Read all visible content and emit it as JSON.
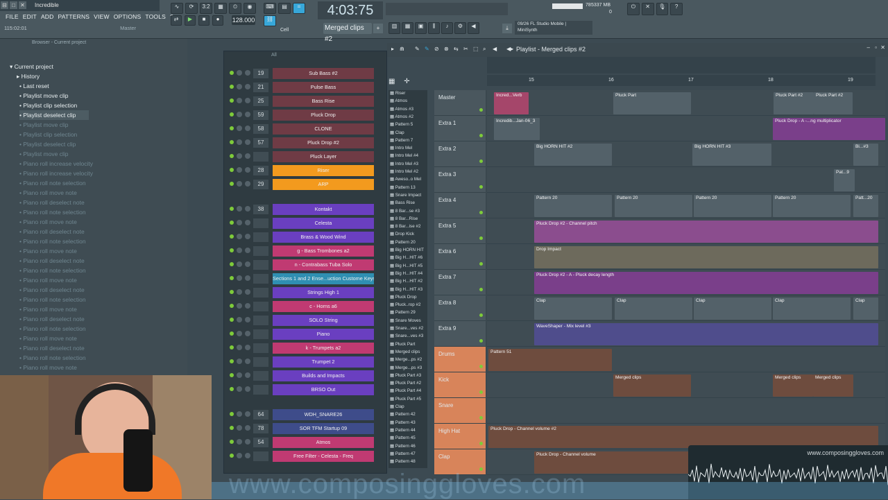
{
  "app": {
    "title": "Incredible",
    "window_buttons": [
      "⊟",
      "□",
      "✕"
    ],
    "menu": [
      "FILE",
      "EDIT",
      "ADD",
      "PATTERNS",
      "VIEW",
      "OPTIONS",
      "TOOLS",
      "?"
    ],
    "hint_left": "115:02:01",
    "hint_right": "Master"
  },
  "transport": {
    "time": "4:03:75",
    "tempo": "128.000",
    "pattern": "Merged clips #2",
    "snap": "Cell",
    "song_counter": "3:2",
    "hint_panel_line1": "09/26  FL Studio Mobile |",
    "hint_panel_line2": "MiniSynth",
    "cpu_value": "78",
    "mem": "5337 MB",
    "mem_small": "0"
  },
  "browser": {
    "header": "Browser - Current project",
    "items": [
      {
        "label": "Current project",
        "bright": true
      },
      {
        "label": "History",
        "bright": true
      },
      {
        "label": "Last reset",
        "bright": true
      },
      {
        "label": "Playlist move clip",
        "bright": true
      },
      {
        "label": "Playlist clip selection",
        "bright": true
      },
      {
        "label": "Playlist deselect clip",
        "bright": true
      },
      {
        "label": "Playlist move clip",
        "bright": false
      },
      {
        "label": "Playlist clip selection",
        "bright": false
      },
      {
        "label": "Playlist deselect clip",
        "bright": false
      },
      {
        "label": "Playlist move clip",
        "bright": false
      },
      {
        "label": "Piano roll increase velocity",
        "bright": false
      },
      {
        "label": "Piano roll increase velocity",
        "bright": false
      },
      {
        "label": "Piano roll note selection",
        "bright": false
      },
      {
        "label": "Piano roll move note",
        "bright": false
      },
      {
        "label": "Piano roll deselect note",
        "bright": false
      },
      {
        "label": "Piano roll note selection",
        "bright": false
      },
      {
        "label": "Piano roll move note",
        "bright": false
      },
      {
        "label": "Piano roll deselect note",
        "bright": false
      },
      {
        "label": "Piano roll note selection",
        "bright": false
      },
      {
        "label": "Piano roll move note",
        "bright": false
      },
      {
        "label": "Piano roll deselect note",
        "bright": false
      },
      {
        "label": "Piano roll note selection",
        "bright": false
      },
      {
        "label": "Piano roll move note",
        "bright": false
      },
      {
        "label": "Piano roll deselect note",
        "bright": false
      },
      {
        "label": "Piano roll note selection",
        "bright": false
      },
      {
        "label": "Piano roll move note",
        "bright": false
      },
      {
        "label": "Piano roll deselect note",
        "bright": false
      },
      {
        "label": "Piano roll note selection",
        "bright": false
      },
      {
        "label": "Piano roll move note",
        "bright": false
      },
      {
        "label": "Piano roll deselect note",
        "bright": false
      },
      {
        "label": "Piano roll note selection",
        "bright": false
      },
      {
        "label": "Piano roll move note",
        "bright": false
      }
    ]
  },
  "channel_rack": {
    "filter": "All",
    "channels": [
      {
        "num": "19",
        "name": "Sub Bass #2",
        "color": "#6f3b45"
      },
      {
        "num": "21",
        "name": "Pulse Bass",
        "color": "#6f3b45"
      },
      {
        "num": "25",
        "name": "Bass Rise",
        "color": "#6f3b45"
      },
      {
        "num": "59",
        "name": "Pluck Drop",
        "color": "#6f3b45"
      },
      {
        "num": "58",
        "name": "CLONE",
        "color": "#6f3b45"
      },
      {
        "num": "57",
        "name": "Pluck Drop #2",
        "color": "#6f3b45"
      },
      {
        "num": "",
        "name": "Pluck Layer",
        "color": "#6f3b45"
      },
      {
        "num": "28",
        "name": "Riser",
        "color": "#f39a1e"
      },
      {
        "num": "29",
        "name": "ARP",
        "color": "#f39a1e"
      },
      {
        "num": "38",
        "name": "Kontakt",
        "color": "#6a3fc0"
      },
      {
        "num": "",
        "name": "Celesta",
        "color": "#6a3fc0"
      },
      {
        "num": "",
        "name": "Brass & Wood Wind",
        "color": "#6a3fc0"
      },
      {
        "num": "",
        "name": "g - Bass Trombones a2",
        "color": "#c03a72"
      },
      {
        "num": "",
        "name": "n - Contrabass Tuba Solo",
        "color": "#c03a72"
      },
      {
        "num": "",
        "name": "Sections 1 and 2 Ense...uction Custome Keys 1",
        "color": "#2f8fb2"
      },
      {
        "num": "",
        "name": "Strings High 1",
        "color": "#6a3fc0"
      },
      {
        "num": "",
        "name": "c - Horns a6",
        "color": "#c03a72"
      },
      {
        "num": "",
        "name": "SOLO String",
        "color": "#6a3fc0"
      },
      {
        "num": "",
        "name": "Piano",
        "color": "#6a3fc0"
      },
      {
        "num": "",
        "name": "k - Trumpets a2",
        "color": "#c03a72"
      },
      {
        "num": "",
        "name": "Trumpet 2",
        "color": "#6a3fc0"
      },
      {
        "num": "",
        "name": "Builds and Impacts",
        "color": "#6a3fc0"
      },
      {
        "num": "",
        "name": "BRSO Out",
        "color": "#6a3fc0"
      },
      {
        "num": "64",
        "name": "WDH_SNARE26",
        "color": "#3e4c8a"
      },
      {
        "num": "78",
        "name": "SOR TFM Startup 09",
        "color": "#3e4c8a"
      },
      {
        "num": "54",
        "name": "Atmos",
        "color": "#c03a72"
      },
      {
        "num": "",
        "name": "Free Filter - Celesta - Freq",
        "color": "#c03a72"
      }
    ]
  },
  "picker": {
    "items": [
      "Riser",
      "Atmos",
      "Atmos #3",
      "Atmos #2",
      "Pattern 5",
      "Clap",
      "Pattern 7",
      "Intro Mel",
      "Intro Mel #4",
      "Intro Mel #3",
      "Intro Mel #2",
      "Aweso..o Mel",
      "Pattern 13",
      "Snare Impact",
      "Bass Rise",
      "8 Bar...se #3",
      "8 Bar...Rise",
      "8 Bar...ise #2",
      "Drop Kick",
      "Pattern 20",
      "Big HORN HIT",
      "Big H...HIT #6",
      "Big H...HIT #5",
      "Big H...HIT #4",
      "Big H...HIT #2",
      "Big H...HIT #3",
      "Pluck Drop",
      "Pluck..rop #2",
      "Pattern 29",
      "Snare Moves",
      "Snare...ves #2",
      "Snare...ves #3",
      "Pluck Part",
      "Merged clips",
      "Merge...ps #2",
      "Merge...ps #3",
      "Pluck Part #3",
      "Pluck Part #2",
      "Pluck Part #4",
      "Pluck Part #5",
      "Clap",
      "Pattern 42",
      "Pattern 43",
      "Pattern 44",
      "Pattern 45",
      "Pattern 46",
      "Pattern 47",
      "Pattern 48"
    ]
  },
  "playlist": {
    "title": "Playlist - Merged clips #2",
    "ruler": [
      "15",
      "16",
      "17",
      "18",
      "19"
    ],
    "tracks": [
      {
        "name": "Master",
        "kind": "normal"
      },
      {
        "name": "Extra 1",
        "kind": "normal"
      },
      {
        "name": "Extra 2",
        "kind": "normal"
      },
      {
        "name": "Extra 3",
        "kind": "normal"
      },
      {
        "name": "Extra 4",
        "kind": "normal"
      },
      {
        "name": "Extra 5",
        "kind": "normal"
      },
      {
        "name": "Extra 6",
        "kind": "normal"
      },
      {
        "name": "Extra 7",
        "kind": "normal"
      },
      {
        "name": "Extra 8",
        "kind": "normal"
      },
      {
        "name": "Extra 9",
        "kind": "normal"
      },
      {
        "name": "Drums",
        "kind": "drum"
      },
      {
        "name": "Kick",
        "kind": "drum"
      },
      {
        "name": "Snare",
        "kind": "drum"
      },
      {
        "name": "High Hat",
        "kind": "drum"
      },
      {
        "name": "Clap",
        "kind": "drum"
      }
    ],
    "clips": [
      {
        "track": 0,
        "start": 10,
        "width": 50,
        "label": "Incred...Verb",
        "color": "#a5466a"
      },
      {
        "track": 0,
        "start": 182,
        "width": 112,
        "label": "Pluck Part",
        "color": "#536169"
      },
      {
        "track": 0,
        "start": 413,
        "width": 58,
        "label": "Pluck Part #2",
        "color": "#536169"
      },
      {
        "track": 0,
        "start": 471,
        "width": 56,
        "label": "Pluck Part #2",
        "color": "#536169"
      },
      {
        "track": 1,
        "start": 10,
        "width": 66,
        "label": "Incredib...Jan-06_3",
        "color": "#536169"
      },
      {
        "track": 1,
        "start": 412,
        "width": 162,
        "label": "Pluck Drop - A -...ng multiplicator",
        "color": "#7a3f8a"
      },
      {
        "track": 2,
        "start": 68,
        "width": 112,
        "label": "Big HORN HIT #2",
        "color": "#536169"
      },
      {
        "track": 2,
        "start": 296,
        "width": 114,
        "label": "Big HORN HIT #3",
        "color": "#536169"
      },
      {
        "track": 2,
        "start": 528,
        "width": 36,
        "label": "Bi...#3",
        "color": "#536169"
      },
      {
        "track": 3,
        "start": 500,
        "width": 30,
        "label": "Pat...9",
        "color": "#536169"
      },
      {
        "track": 4,
        "start": 68,
        "width": 112,
        "label": "Pattern 20",
        "color": "#536169"
      },
      {
        "track": 4,
        "start": 184,
        "width": 112,
        "label": "Pattern 20",
        "color": "#536169"
      },
      {
        "track": 4,
        "start": 298,
        "width": 112,
        "label": "Pattern 20",
        "color": "#536169"
      },
      {
        "track": 4,
        "start": 412,
        "width": 112,
        "label": "Pattern 20",
        "color": "#536169"
      },
      {
        "track": 4,
        "start": 528,
        "width": 36,
        "label": "Patt...20",
        "color": "#536169"
      },
      {
        "track": 5,
        "start": 68,
        "width": 496,
        "label": "Pluck Drop #2 - Channel pitch",
        "color": "#8b4d8e"
      },
      {
        "track": 6,
        "start": 68,
        "width": 496,
        "label": "Drop Impact",
        "color": "#6d6a5c"
      },
      {
        "track": 7,
        "start": 68,
        "width": 496,
        "label": "Pluck Drop #2 - A - Pluck decay length",
        "color": "#7a3f8a"
      },
      {
        "track": 8,
        "start": 68,
        "width": 112,
        "label": "Clap",
        "color": "#536169"
      },
      {
        "track": 8,
        "start": 184,
        "width": 112,
        "label": "Clap",
        "color": "#536169"
      },
      {
        "track": 8,
        "start": 298,
        "width": 112,
        "label": "Clap",
        "color": "#536169"
      },
      {
        "track": 8,
        "start": 412,
        "width": 112,
        "label": "Clap",
        "color": "#536169"
      },
      {
        "track": 8,
        "start": 528,
        "width": 36,
        "label": "Clap",
        "color": "#536169"
      },
      {
        "track": 9,
        "start": 68,
        "width": 496,
        "label": "WaveShaper - Mix level #3",
        "color": "#4f4d8c"
      },
      {
        "track": 10,
        "start": 2,
        "width": 178,
        "label": "Pattern 51",
        "color": "#6e4c3e"
      },
      {
        "track": 11,
        "start": 182,
        "width": 112,
        "label": "Merged clips",
        "color": "#6e4c3e"
      },
      {
        "track": 11,
        "start": 412,
        "width": 58,
        "label": "Merged clips",
        "color": "#6e4c3e"
      },
      {
        "track": 11,
        "start": 470,
        "width": 58,
        "label": "Merged clips",
        "color": "#6e4c3e"
      },
      {
        "track": 13,
        "start": 2,
        "width": 562,
        "label": "Pluck Drop - Channel volume #2",
        "color": "#6e4c3e"
      },
      {
        "track": 14,
        "start": 68,
        "width": 496,
        "label": "Pluck Drop - Channel volume",
        "color": "#6e4c3e"
      }
    ]
  },
  "overlay": {
    "wave_label": "www.composinggloves.com",
    "watermark": "www.composinggloves.com"
  }
}
